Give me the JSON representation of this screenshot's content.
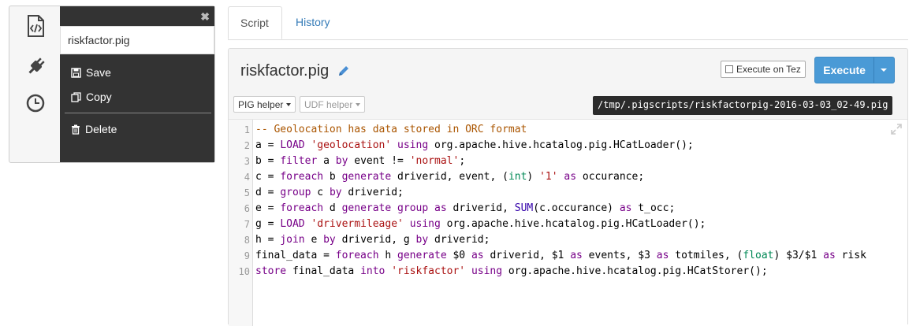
{
  "sidebar": {
    "icons": [
      "code-file-icon",
      "plug-icon",
      "clock-icon"
    ]
  },
  "file_panel": {
    "close_glyph": "✖",
    "filename_value": "riskfactor.pig",
    "menu": [
      {
        "label": "Save",
        "icon": "save-icon"
      },
      {
        "label": "Copy",
        "icon": "copy-icon"
      },
      {
        "label": "Delete",
        "icon": "trash-icon"
      }
    ]
  },
  "tabs": [
    {
      "label": "Script",
      "active": true
    },
    {
      "label": "History",
      "active": false
    }
  ],
  "editor_header": {
    "title": "riskfactor.pig",
    "execute_on_tez_label": "Execute on Tez",
    "execute_label": "Execute",
    "pig_helper_label": "PIG helper",
    "udf_helper_label": "UDF helper",
    "script_path": "/tmp/.pigscripts/riskfactorpig-2016-03-03_02-49.pig"
  },
  "code": {
    "line_numbers": [
      "1",
      "2",
      "3",
      "4",
      "5",
      "6",
      "7",
      "8",
      "9",
      "10"
    ],
    "lines": [
      [
        {
          "t": "-- Geolocation has data stored in ORC format",
          "c": "c"
        }
      ],
      [
        {
          "t": "a = "
        },
        {
          "t": "LOAD",
          "c": "k"
        },
        {
          "t": " "
        },
        {
          "t": "'geolocation'",
          "c": "s"
        },
        {
          "t": " "
        },
        {
          "t": "using",
          "c": "k"
        },
        {
          "t": " org.apache.hive.hcatalog.pig.HCatLoader();"
        }
      ],
      [
        {
          "t": "b = "
        },
        {
          "t": "filter",
          "c": "k"
        },
        {
          "t": " a "
        },
        {
          "t": "by",
          "c": "k"
        },
        {
          "t": " event != "
        },
        {
          "t": "'normal'",
          "c": "s"
        },
        {
          "t": ";"
        }
      ],
      [
        {
          "t": "c = "
        },
        {
          "t": "foreach",
          "c": "k"
        },
        {
          "t": " b "
        },
        {
          "t": "generate",
          "c": "k"
        },
        {
          "t": " driverid, event, ("
        },
        {
          "t": "int",
          "c": "t"
        },
        {
          "t": ") "
        },
        {
          "t": "'1'",
          "c": "s"
        },
        {
          "t": " "
        },
        {
          "t": "as",
          "c": "k"
        },
        {
          "t": " occurance;"
        }
      ],
      [
        {
          "t": "d = "
        },
        {
          "t": "group",
          "c": "k"
        },
        {
          "t": " c "
        },
        {
          "t": "by",
          "c": "k"
        },
        {
          "t": " driverid;"
        }
      ],
      [
        {
          "t": "e = "
        },
        {
          "t": "foreach",
          "c": "k"
        },
        {
          "t": " d "
        },
        {
          "t": "generate",
          "c": "k"
        },
        {
          "t": " "
        },
        {
          "t": "group",
          "c": "k"
        },
        {
          "t": " "
        },
        {
          "t": "as",
          "c": "k"
        },
        {
          "t": " driverid, "
        },
        {
          "t": "SUM",
          "c": "b"
        },
        {
          "t": "(c.occurance) "
        },
        {
          "t": "as",
          "c": "k"
        },
        {
          "t": " t_occ;"
        }
      ],
      [
        {
          "t": "g = "
        },
        {
          "t": "LOAD",
          "c": "k"
        },
        {
          "t": " "
        },
        {
          "t": "'drivermileage'",
          "c": "s"
        },
        {
          "t": " "
        },
        {
          "t": "using",
          "c": "k"
        },
        {
          "t": " org.apache.hive.hcatalog.pig.HCatLoader();"
        }
      ],
      [
        {
          "t": "h = "
        },
        {
          "t": "join",
          "c": "k"
        },
        {
          "t": " e "
        },
        {
          "t": "by",
          "c": "k"
        },
        {
          "t": " driverid, g "
        },
        {
          "t": "by",
          "c": "k"
        },
        {
          "t": " driverid;"
        }
      ],
      [
        {
          "t": "final_data = "
        },
        {
          "t": "foreach",
          "c": "k"
        },
        {
          "t": " h "
        },
        {
          "t": "generate",
          "c": "k"
        },
        {
          "t": " $0 "
        },
        {
          "t": "as",
          "c": "k"
        },
        {
          "t": " driverid, $1 "
        },
        {
          "t": "as",
          "c": "k"
        },
        {
          "t": " events, $3 "
        },
        {
          "t": "as",
          "c": "k"
        },
        {
          "t": " totmiles, ("
        },
        {
          "t": "float",
          "c": "t"
        },
        {
          "t": ") $3/$1 "
        },
        {
          "t": "as",
          "c": "k"
        },
        {
          "t": " risk"
        }
      ],
      [
        {
          "t": "store",
          "c": "k"
        },
        {
          "t": " final_data "
        },
        {
          "t": "into",
          "c": "k"
        },
        {
          "t": " "
        },
        {
          "t": "'riskfactor'",
          "c": "s"
        },
        {
          "t": " "
        },
        {
          "t": "using",
          "c": "k"
        },
        {
          "t": " org.apache.hive.hcatalog.pig.HCatStorer();"
        }
      ]
    ]
  },
  "colors": {
    "dark_panel": "#333333",
    "execute_button": "#4a9ad6",
    "link": "#337ab7",
    "keyword": "#770088",
    "string": "#aa1111",
    "comment": "#aa5500"
  }
}
